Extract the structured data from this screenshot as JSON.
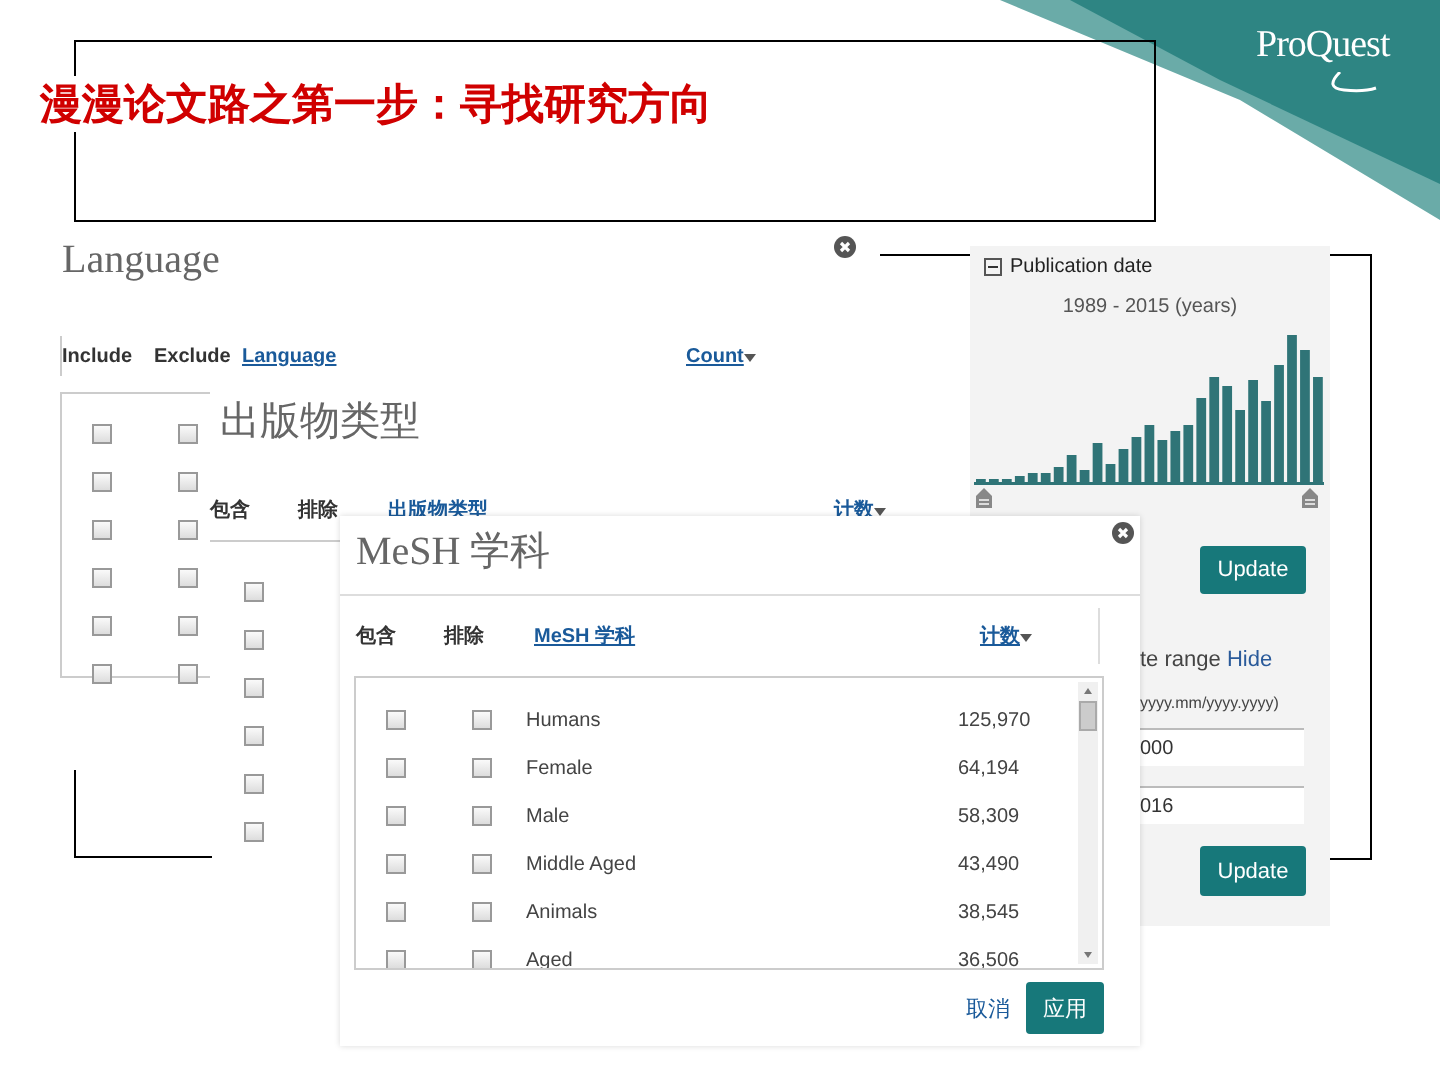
{
  "title": "漫漫论文路之第一步：寻找研究方向",
  "logo": "ProQuest",
  "language_panel": {
    "heading": "Language",
    "columns": [
      "Include",
      "Exclude",
      "Language",
      "Count"
    ],
    "rows": [
      {
        "include_checked": false,
        "exclude_checked": false
      },
      {
        "include_checked": false,
        "exclude_checked": false
      },
      {
        "include_checked": false,
        "exclude_checked": false
      },
      {
        "include_checked": false,
        "exclude_checked": false
      },
      {
        "include_checked": false,
        "exclude_checked": false
      },
      {
        "include_checked": false,
        "exclude_checked": false
      }
    ]
  },
  "publication_type_panel": {
    "heading": "出版物类型",
    "columns": [
      "包含",
      "排除",
      "出版物类型",
      "计数"
    ],
    "rows": [
      {
        "include_checked": false
      },
      {
        "include_checked": false
      },
      {
        "include_checked": false
      },
      {
        "include_checked": false
      },
      {
        "include_checked": false
      },
      {
        "include_checked": false
      }
    ]
  },
  "publication_date_panel": {
    "title": "Publication date",
    "expanded": true,
    "range": "1989 - 2015 (years)",
    "update_button": "Update",
    "range_label": "te range",
    "hide_link": "Hide",
    "format_hint": "yyyy.mm/yyyy.yyyy)",
    "from_value": "000",
    "to_value": "016",
    "update_button_2": "Update"
  },
  "mesh_panel": {
    "heading": "MeSH 学科",
    "columns": [
      "包含",
      "排除",
      "MeSH 学科",
      "计数"
    ],
    "rows": [
      {
        "include_checked": false,
        "exclude_checked": false,
        "term": "Humans",
        "count": "125,970"
      },
      {
        "include_checked": false,
        "exclude_checked": false,
        "term": "Female",
        "count": "64,194"
      },
      {
        "include_checked": false,
        "exclude_checked": false,
        "term": "Male",
        "count": "58,309"
      },
      {
        "include_checked": false,
        "exclude_checked": false,
        "term": "Middle Aged",
        "count": "43,490"
      },
      {
        "include_checked": false,
        "exclude_checked": false,
        "term": "Animals",
        "count": "38,545"
      },
      {
        "include_checked": false,
        "exclude_checked": false,
        "term": "Aged",
        "count": "36,506"
      }
    ],
    "cancel_link": "取消",
    "apply_button": "应用"
  }
}
